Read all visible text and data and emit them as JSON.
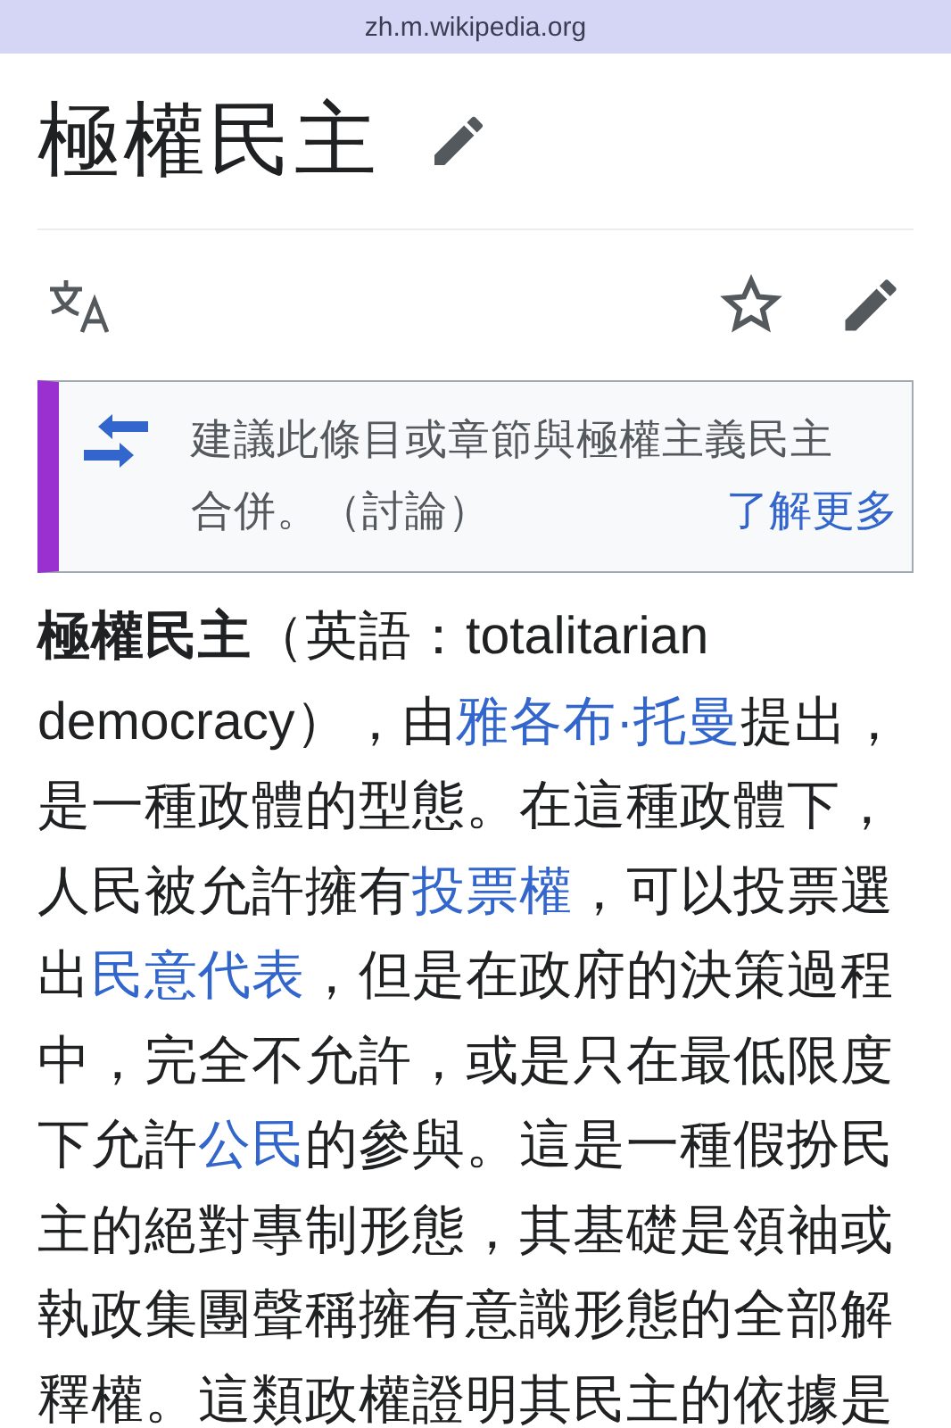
{
  "address_bar": {
    "url": "zh.m.wikipedia.org"
  },
  "title": "極權民主",
  "notice": {
    "lines": [
      "建議此條目或章節與極權主義民主",
      "合併。（討論）"
    ],
    "link": "了解更多"
  },
  "paragraph": [
    {
      "kind": "bold",
      "text": "極權民主"
    },
    {
      "kind": "text",
      "text": "（英語：totalitarian democracy），由"
    },
    {
      "kind": "link",
      "text": "雅各布·托曼"
    },
    {
      "kind": "text",
      "text": "提出，是一種政體的型態。在這種政體下，人民被允許擁有"
    },
    {
      "kind": "link",
      "text": "投票權"
    },
    {
      "kind": "text",
      "text": "，可以投票選出"
    },
    {
      "kind": "link",
      "text": "民意代表"
    },
    {
      "kind": "text",
      "text": "，但是在政府的決策過程中，完全不允許，或是只在最低限度下允許"
    },
    {
      "kind": "link",
      "text": "公民"
    },
    {
      "kind": "text",
      "text": "的參與。這是一種假扮民主的絕對專制形態，其基礎是領袖或執政集團聲稱擁有意識形態的全部解釋權。這類政權證明其民主的依據是"
    }
  ]
}
